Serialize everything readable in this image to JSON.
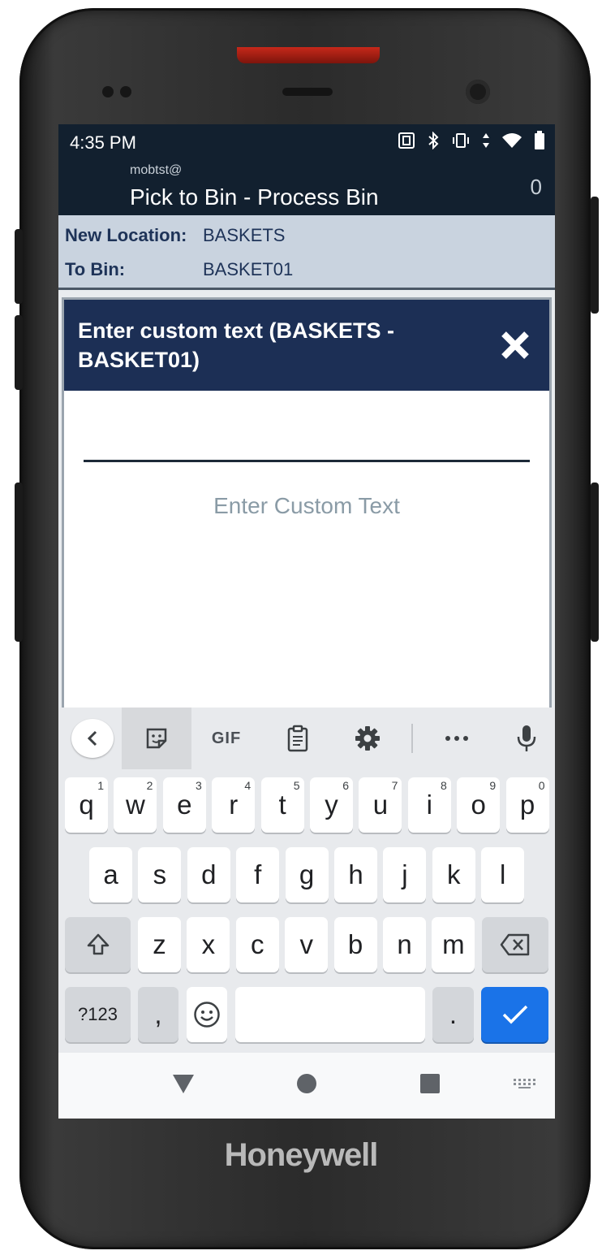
{
  "brand": "Honeywell",
  "status_bar": {
    "time": "4:35 PM",
    "icons": [
      "nfc-icon",
      "bluetooth-icon",
      "vibrate-icon",
      "data-arrows-icon",
      "wifi-icon",
      "battery-icon"
    ]
  },
  "header": {
    "user": "mobtst@",
    "title": "Pick to Bin - Process Bin",
    "count": "0"
  },
  "info": {
    "new_location_label": "New Location:",
    "new_location_value": "BASKETS",
    "to_bin_label": "To Bin:",
    "to_bin_value": "BASKET01"
  },
  "dialog": {
    "title": "Enter custom text (BASKETS - BASKET01)",
    "input_value": "",
    "hint": "Enter Custom Text"
  },
  "keyboard": {
    "toolbar": [
      "back-chevron-icon",
      "sticker-icon",
      "GIF",
      "clipboard-icon",
      "settings-icon",
      "more-icon",
      "mic-icon"
    ],
    "gif_label": "GIF",
    "row1": [
      {
        "k": "q",
        "h": "1"
      },
      {
        "k": "w",
        "h": "2"
      },
      {
        "k": "e",
        "h": "3"
      },
      {
        "k": "r",
        "h": "4"
      },
      {
        "k": "t",
        "h": "5"
      },
      {
        "k": "y",
        "h": "6"
      },
      {
        "k": "u",
        "h": "7"
      },
      {
        "k": "i",
        "h": "8"
      },
      {
        "k": "o",
        "h": "9"
      },
      {
        "k": "p",
        "h": "0"
      }
    ],
    "row2": [
      "a",
      "s",
      "d",
      "f",
      "g",
      "h",
      "j",
      "k",
      "l"
    ],
    "row3": [
      "z",
      "x",
      "c",
      "v",
      "b",
      "n",
      "m"
    ],
    "symbols_label": "?123",
    "comma": ",",
    "period": "."
  },
  "colors": {
    "header_bg": "#12202f",
    "dialog_header_bg": "#1c2f55",
    "info_panel_bg": "#c9d3df",
    "action_key": "#1a73e8"
  }
}
